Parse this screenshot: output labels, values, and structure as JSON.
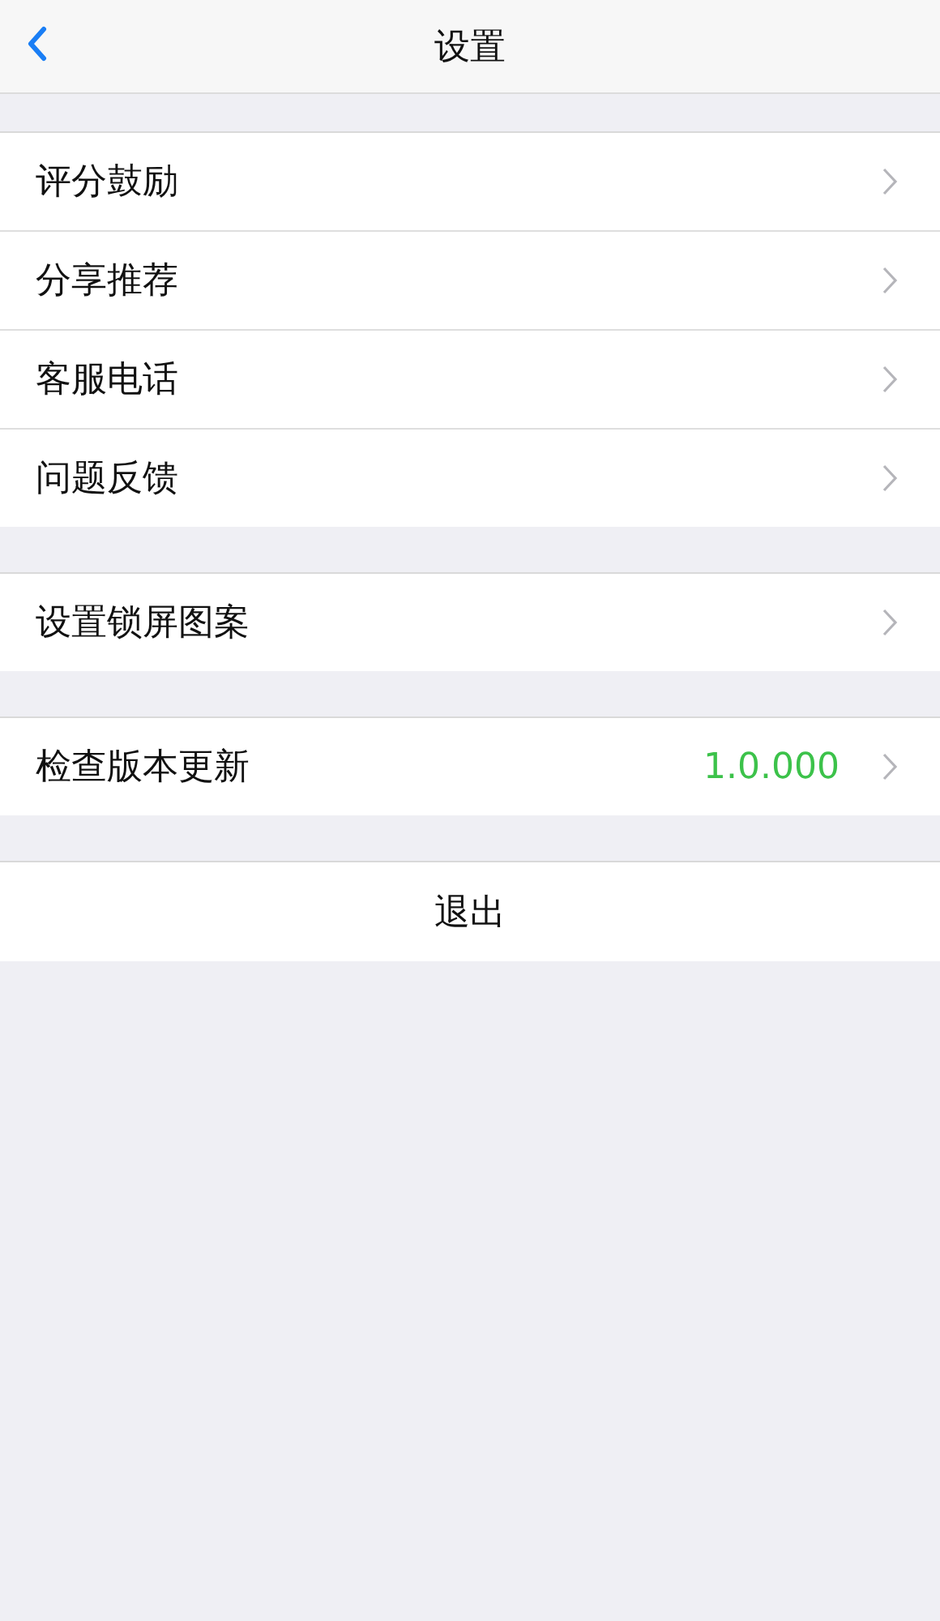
{
  "header": {
    "title": "设置"
  },
  "groups": [
    {
      "items": [
        {
          "label": "评分鼓励"
        },
        {
          "label": "分享推荐"
        },
        {
          "label": "客服电话"
        },
        {
          "label": "问题反馈"
        }
      ]
    },
    {
      "items": [
        {
          "label": "设置锁屏图案"
        }
      ]
    },
    {
      "items": [
        {
          "label": "检查版本更新",
          "value": "1.0.000"
        }
      ]
    }
  ],
  "logout": {
    "label": "退出"
  }
}
